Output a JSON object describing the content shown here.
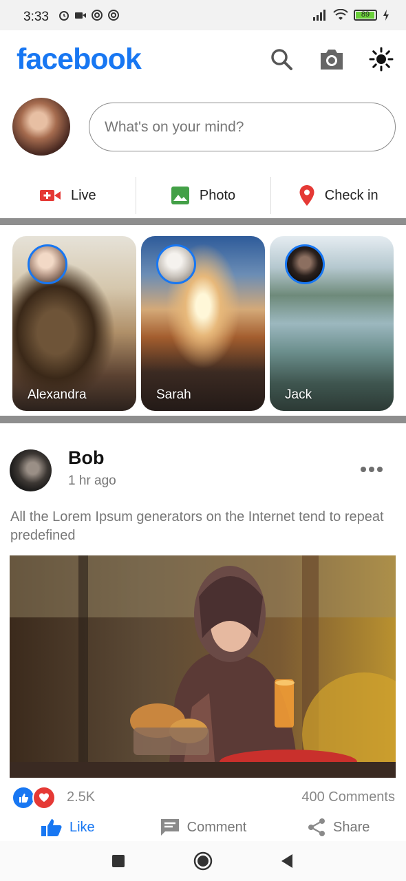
{
  "status_bar": {
    "time": "3:33",
    "battery": "89",
    "battery_level": 0.89,
    "icons": [
      "alarm-icon",
      "video-icon",
      "sync-icon",
      "vpn-icon",
      "signal-icon",
      "wifi-icon",
      "battery-icon",
      "charging-icon"
    ]
  },
  "app_bar": {
    "logo": "facebook",
    "brand_color": "#1877f2",
    "icons": [
      "search-icon",
      "camera-icon",
      "brightness-icon"
    ]
  },
  "composer": {
    "placeholder": "What's on your mind?"
  },
  "actions": [
    {
      "label": "Live",
      "icon": "live-video-icon",
      "color": "#e53935"
    },
    {
      "label": "Photo",
      "icon": "photo-icon",
      "color": "#43a047"
    },
    {
      "label": "Check in",
      "icon": "location-pin-icon",
      "color": "#e53935"
    }
  ],
  "stories": [
    {
      "name": "Alexandra"
    },
    {
      "name": "Sarah"
    },
    {
      "name": "Jack"
    }
  ],
  "post": {
    "author": "Bob",
    "time": "1 hr ago",
    "text": "All the Lorem Ipsum generators on the Internet tend to repeat predefined",
    "likes": "2.5K",
    "comments": "400 Comments",
    "reaction_icons": [
      "like-reaction-icon",
      "love-reaction-icon"
    ],
    "actions": [
      {
        "label": "Like",
        "icon": "thumbs-up-icon"
      },
      {
        "label": "Comment",
        "icon": "comment-icon"
      },
      {
        "label": "Share",
        "icon": "share-icon"
      }
    ]
  },
  "nav_bar": {
    "icons": [
      "recents-square-icon",
      "home-circle-icon",
      "back-triangle-icon"
    ]
  }
}
